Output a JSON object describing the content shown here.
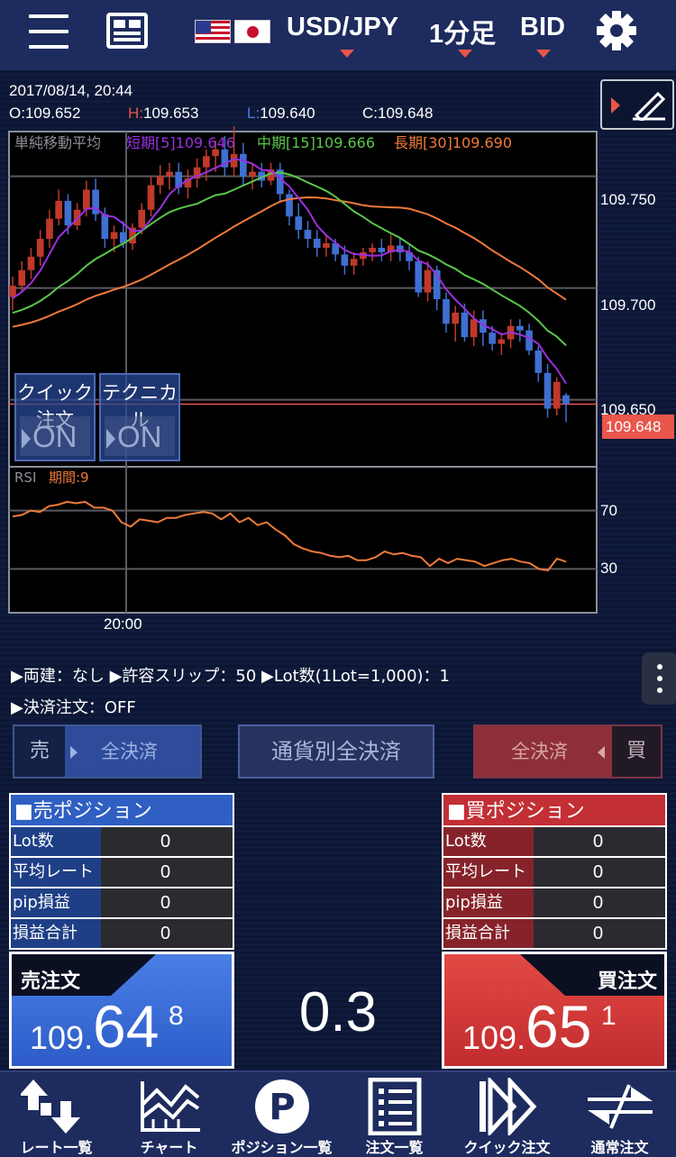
{
  "header": {
    "pair": "USD/JPY",
    "timeframe": "1分足",
    "price_type": "BID"
  },
  "chart": {
    "datetime": "2017/08/14, 20:44",
    "open": "O:109.652",
    "high_prefix": "H:",
    "high_value": "109.653",
    "low_prefix": "L:",
    "low_value": "109.640",
    "close": "C:109.648",
    "sma_label": "単純移動平均",
    "sma_short": "短期[5]109.646",
    "sma_mid": "中期[15]109.666",
    "sma_long": "長期[30]109.690",
    "current_price": "109.648",
    "rsi_label": "RSI",
    "rsi_period": "期間:9",
    "x_tick": "20:00",
    "quick_order_label": "クイック注文",
    "quick_order_state": "ON",
    "technical_label": "テクニカル",
    "technical_state": "ON",
    "colors": {
      "up": "#c0392b",
      "down": "#3f6fd1",
      "sma_short": "#9b30e0",
      "sma_mid": "#59c74a",
      "sma_long": "#f07a3a",
      "rsi": "#f07a3a"
    }
  },
  "chart_data": [
    {
      "type": "line",
      "title": "USD/JPY 1分足",
      "y_ticks": [
        "109.750",
        "109.700",
        "109.650"
      ],
      "ylim": [
        109.62,
        109.77
      ],
      "x_ticks": [
        "20:00"
      ],
      "series": [
        {
          "name": "短期[5]",
          "last": 109.646
        },
        {
          "name": "中期[15]",
          "last": 109.666
        },
        {
          "name": "長期[30]",
          "last": 109.69
        }
      ],
      "candles": [
        [
          109.696,
          109.705,
          109.69,
          109.701
        ],
        [
          109.701,
          109.712,
          109.698,
          109.708
        ],
        [
          109.708,
          109.718,
          109.704,
          109.714
        ],
        [
          109.714,
          109.726,
          109.71,
          109.722
        ],
        [
          109.722,
          109.735,
          109.718,
          109.731
        ],
        [
          109.731,
          109.744,
          109.728,
          109.739
        ],
        [
          109.739,
          109.742,
          109.724,
          109.728
        ],
        [
          109.728,
          109.738,
          109.726,
          109.735
        ],
        [
          109.735,
          109.748,
          109.732,
          109.744
        ],
        [
          109.744,
          109.749,
          109.73,
          109.733
        ],
        [
          109.733,
          109.736,
          109.718,
          109.722
        ],
        [
          109.722,
          109.728,
          109.716,
          109.725
        ],
        [
          109.725,
          109.73,
          109.718,
          109.72
        ],
        [
          109.72,
          109.729,
          109.717,
          109.727
        ],
        [
          109.727,
          109.738,
          109.724,
          109.735
        ],
        [
          109.735,
          109.75,
          109.732,
          109.746
        ],
        [
          109.746,
          109.755,
          109.742,
          109.75
        ],
        [
          109.75,
          109.756,
          109.744,
          109.752
        ],
        [
          109.752,
          109.756,
          109.742,
          109.745
        ],
        [
          109.745,
          109.753,
          109.74,
          109.749
        ],
        [
          109.749,
          109.758,
          109.745,
          109.754
        ],
        [
          109.754,
          109.762,
          109.748,
          109.759
        ],
        [
          109.759,
          109.766,
          109.752,
          109.762
        ],
        [
          109.762,
          109.768,
          109.75,
          109.754
        ],
        [
          109.754,
          109.776,
          109.75,
          109.76
        ],
        [
          109.76,
          109.765,
          109.746,
          109.75
        ],
        [
          109.75,
          109.756,
          109.744,
          109.752
        ],
        [
          109.752,
          109.756,
          109.745,
          109.748
        ],
        [
          109.748,
          109.756,
          109.746,
          109.753
        ],
        [
          109.753,
          109.756,
          109.738,
          109.742
        ],
        [
          109.742,
          109.744,
          109.728,
          109.732
        ],
        [
          109.732,
          109.738,
          109.722,
          109.726
        ],
        [
          109.726,
          109.73,
          109.718,
          109.722
        ],
        [
          109.722,
          109.726,
          109.714,
          109.718
        ],
        [
          109.718,
          109.724,
          109.714,
          109.72
        ],
        [
          109.72,
          109.722,
          109.712,
          109.715
        ],
        [
          109.715,
          109.719,
          109.706,
          109.71
        ],
        [
          109.71,
          109.716,
          109.706,
          109.713
        ],
        [
          109.713,
          109.718,
          109.71,
          109.716
        ],
        [
          109.716,
          109.72,
          109.712,
          109.718
        ],
        [
          109.718,
          109.722,
          109.712,
          109.716
        ],
        [
          109.716,
          109.724,
          109.712,
          109.719
        ],
        [
          109.719,
          109.723,
          109.712,
          109.716
        ],
        [
          109.716,
          109.719,
          109.708,
          109.712
        ],
        [
          109.712,
          109.714,
          109.696,
          109.698
        ],
        [
          109.698,
          109.712,
          109.694,
          109.708
        ],
        [
          109.708,
          109.71,
          109.69,
          109.695
        ],
        [
          109.695,
          109.698,
          109.68,
          109.684
        ],
        [
          109.684,
          109.692,
          109.676,
          109.689
        ],
        [
          109.689,
          109.693,
          109.676,
          109.678
        ],
        [
          109.678,
          109.69,
          109.674,
          109.686
        ],
        [
          109.686,
          109.69,
          109.674,
          109.68
        ],
        [
          109.68,
          109.683,
          109.672,
          109.675
        ],
        [
          109.675,
          109.68,
          109.67,
          109.677
        ],
        [
          109.677,
          109.686,
          109.673,
          109.683
        ],
        [
          109.683,
          109.686,
          109.676,
          109.681
        ],
        [
          109.681,
          109.684,
          109.67,
          109.672
        ],
        [
          109.672,
          109.674,
          109.658,
          109.662
        ],
        [
          109.662,
          109.666,
          109.642,
          109.646
        ],
        [
          109.646,
          109.66,
          109.643,
          109.658
        ],
        [
          109.652,
          109.653,
          109.64,
          109.648
        ]
      ]
    },
    {
      "type": "line",
      "title": "RSI 期間:9",
      "y_ticks": [
        "70",
        "30"
      ],
      "ylim": [
        0,
        100
      ],
      "series": [
        {
          "name": "RSI",
          "values": [
            66,
            67,
            70,
            69,
            73,
            74,
            76,
            75,
            76,
            72,
            72,
            70,
            62,
            59,
            64,
            63,
            62,
            65,
            65,
            67,
            68,
            69,
            68,
            64,
            68,
            62,
            65,
            60,
            62,
            57,
            53,
            47,
            44,
            42,
            41,
            39,
            38,
            39,
            36,
            36,
            38,
            42,
            40,
            41,
            39,
            38,
            32,
            37,
            34,
            37,
            36,
            35,
            32,
            34,
            36,
            37,
            35,
            34,
            30,
            29,
            37,
            35
          ]
        }
      ]
    }
  ],
  "settings": {
    "line1": "▶両建：なし ▶許容スリップ：50 ▶Lot数(1Lot=1,000)：1",
    "line2": "▶決済注文：OFF"
  },
  "close_buttons": {
    "sell_side": "売",
    "sell_all": "全決済",
    "by_currency": "通貨別全決済",
    "buy_all": "全決済",
    "buy_side": "買"
  },
  "sell_position": {
    "title": "■売ポジション",
    "rows": [
      {
        "label": "Lot数",
        "value": "0"
      },
      {
        "label": "平均レート",
        "value": "0"
      },
      {
        "label": "pip損益",
        "value": "0"
      },
      {
        "label": "損益合計",
        "value": "0"
      }
    ]
  },
  "buy_position": {
    "title": "■買ポジション",
    "rows": [
      {
        "label": "Lot数",
        "value": "0"
      },
      {
        "label": "平均レート",
        "value": "0"
      },
      {
        "label": "pip損益",
        "value": "0"
      },
      {
        "label": "損益合計",
        "value": "0"
      }
    ]
  },
  "sell_order": {
    "label": "売注文",
    "price_prefix": "109.",
    "price_main": "64",
    "price_sup": "8",
    "color": "#3a6fd8"
  },
  "buy_order": {
    "label": "買注文",
    "price_prefix": "109.",
    "price_main": "65",
    "price_sup": "1",
    "color": "#d8383a"
  },
  "spread": "0.3",
  "nav": [
    {
      "label": "レート一覧",
      "icon": "rate-list-icon"
    },
    {
      "label": "チャート",
      "icon": "chart-icon"
    },
    {
      "label": "ポジション一覧",
      "icon": "position-icon"
    },
    {
      "label": "注文一覧",
      "icon": "order-list-icon"
    },
    {
      "label": "クイック注文",
      "icon": "quick-order-icon"
    },
    {
      "label": "通常注文",
      "icon": "normal-order-icon"
    }
  ]
}
